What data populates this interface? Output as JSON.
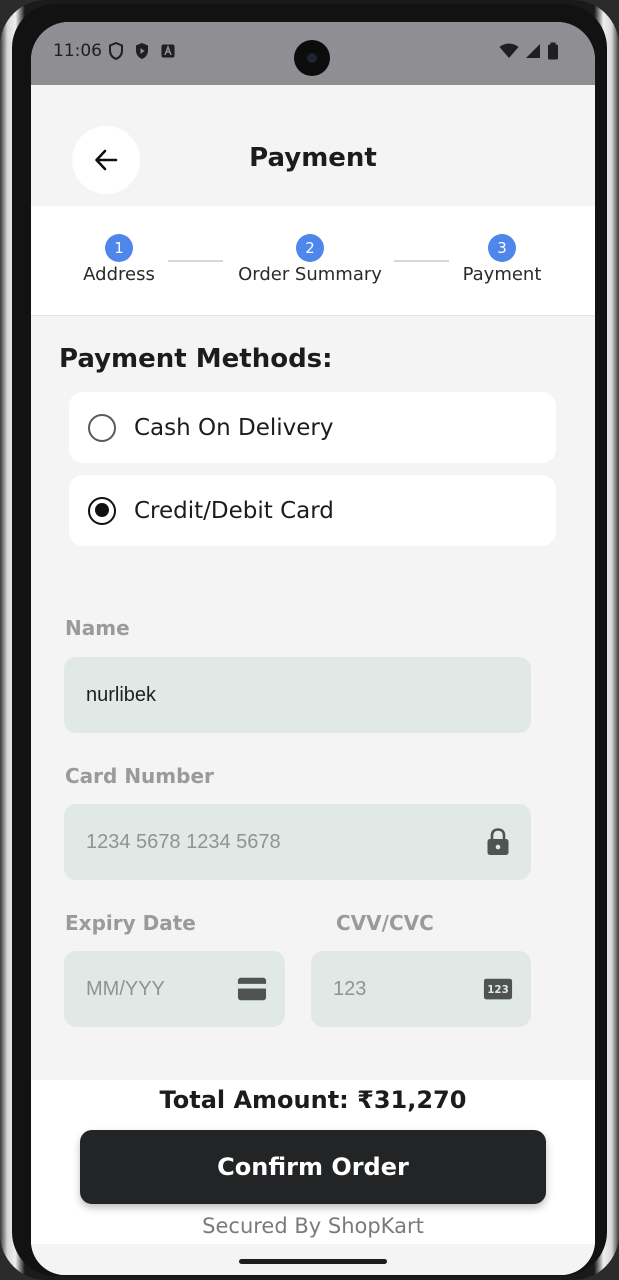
{
  "status_bar": {
    "time": "11:06"
  },
  "header": {
    "title": "Payment",
    "back_icon": "arrow-left-icon"
  },
  "stepper": {
    "steps": [
      {
        "number": "1",
        "label": "Address"
      },
      {
        "number": "2",
        "label": "Order Summary"
      },
      {
        "number": "3",
        "label": "Payment"
      }
    ],
    "accent_color": "#4f86ec"
  },
  "payment_methods": {
    "title": "Payment Methods:",
    "options": [
      {
        "label": "Cash On Delivery",
        "selected": false
      },
      {
        "label": "Credit/Debit Card",
        "selected": true
      }
    ]
  },
  "form": {
    "name": {
      "label": "Name",
      "value": "nurlibek"
    },
    "card_number": {
      "label": "Card Number",
      "placeholder": "1234 5678 1234 5678",
      "icon": "lock-icon"
    },
    "expiry": {
      "label": "Expiry Date",
      "placeholder": "MM/YYY",
      "icon": "credit-card-icon"
    },
    "cvv": {
      "label": "CVV/CVC",
      "placeholder": "123",
      "icon": "pin-123-icon"
    }
  },
  "footer": {
    "total": "Total Amount: ₹31,270",
    "confirm_label": "Confirm Order",
    "secured_text": "Secured By ShopKart"
  }
}
